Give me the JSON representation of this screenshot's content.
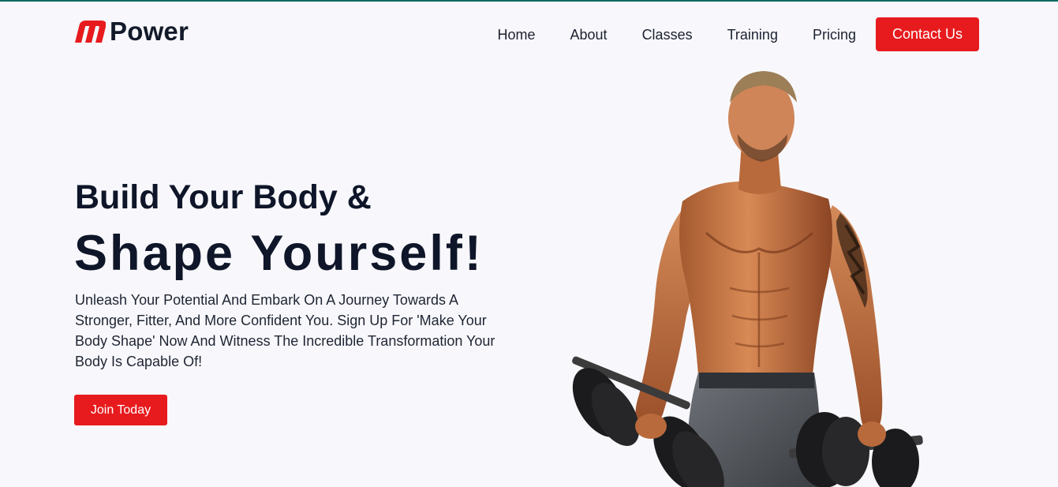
{
  "brand": {
    "logo_letter": "m",
    "name": "Power"
  },
  "nav": {
    "links": [
      "Home",
      "About",
      "Classes",
      "Training",
      "Pricing"
    ],
    "contact_label": "Contact Us"
  },
  "hero": {
    "title_line1": "Build Your Body &",
    "title_line2": "Shape Yourself!",
    "description": "Unleash Your Potential And Embark On A Journey Towards A Stronger, Fitter, And More Confident You. Sign Up For 'Make Your Body Shape' Now And Witness The Incredible Transformation Your Body Is Capable Of!",
    "cta_label": "Join Today",
    "image": "muscular man holding dumbbells"
  },
  "colors": {
    "accent": "#e71b1e",
    "text_dark": "#0f1629",
    "background": "#f8f8fc",
    "top_border": "#0f6b63"
  }
}
